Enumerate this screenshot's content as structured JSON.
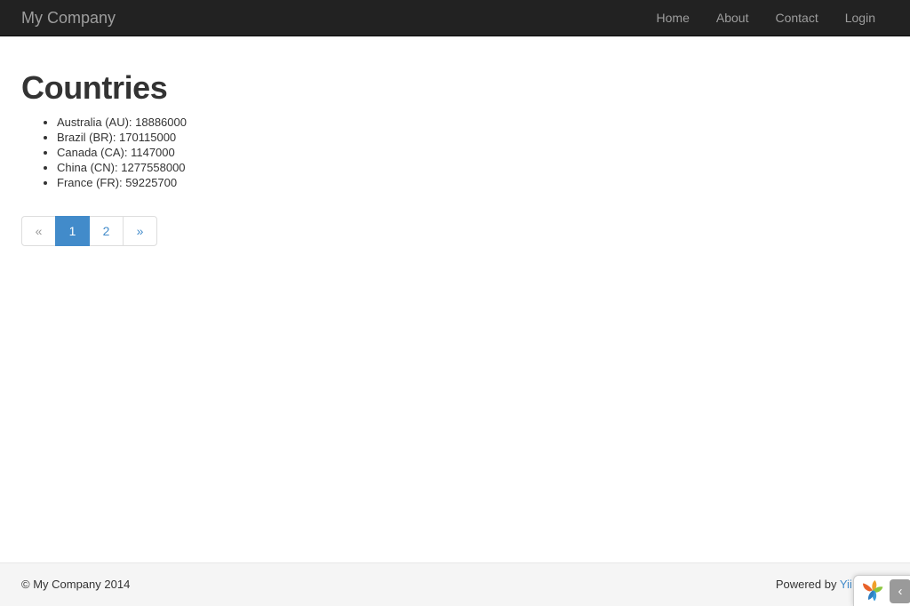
{
  "navbar": {
    "brand": "My Company",
    "links": [
      {
        "label": "Home",
        "name": "nav-link-home"
      },
      {
        "label": "About",
        "name": "nav-link-about"
      },
      {
        "label": "Contact",
        "name": "nav-link-contact"
      },
      {
        "label": "Login",
        "name": "nav-link-login"
      }
    ]
  },
  "main": {
    "title": "Countries",
    "countries": [
      "Australia (AU): 18886000",
      "Brazil (BR): 170115000",
      "Canada (CA): 1147000",
      "China (CN): 1277558000",
      "France (FR): 59225700"
    ]
  },
  "pagination": {
    "prev_label": "«",
    "next_label": "»",
    "pages": [
      "1",
      "2"
    ],
    "active_page": "1"
  },
  "footer": {
    "copyright": "© My Company 2014",
    "powered_by_prefix": "Powered by ",
    "powered_by_link": "Yii Frame"
  },
  "debug_toolbar": {
    "toggle_label": "‹"
  },
  "colors": {
    "navbar_bg": "#222222",
    "navbar_text": "#9d9d9d",
    "accent": "#428bca",
    "footer_bg": "#f5f5f5",
    "body_text": "#333333",
    "muted": "#999999"
  }
}
